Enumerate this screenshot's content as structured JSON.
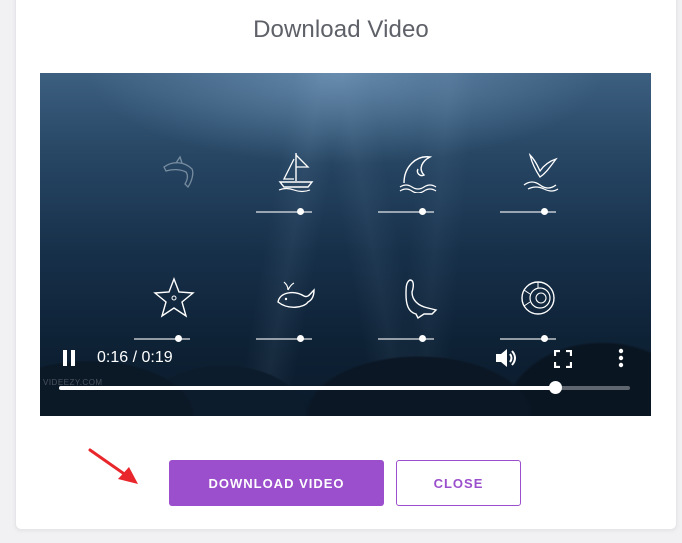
{
  "dialog": {
    "title": "Download Video"
  },
  "video": {
    "time_display": "0:16 / 0:19",
    "progress": 0.868,
    "watermark": "VIDEEZY.COM",
    "icons": [
      {
        "name": "dolphin-icon",
        "slider": null
      },
      {
        "name": "sailboat-icon",
        "slider": 0.8
      },
      {
        "name": "wave-icon",
        "slider": 0.8
      },
      {
        "name": "seabird-icon",
        "slider": 0.8
      },
      {
        "name": "starfish-icon",
        "slider": 0.8
      },
      {
        "name": "whale-icon",
        "slider": 0.8
      },
      {
        "name": "seal-icon",
        "slider": 0.8
      },
      {
        "name": "shell-icon",
        "slider": 0.8
      }
    ]
  },
  "actions": {
    "download_label": "DOWNLOAD VIDEO",
    "close_label": "CLOSE"
  },
  "colors": {
    "accent": "#9b4fcc",
    "title": "#5f6169",
    "arrow": "#e8262b"
  }
}
